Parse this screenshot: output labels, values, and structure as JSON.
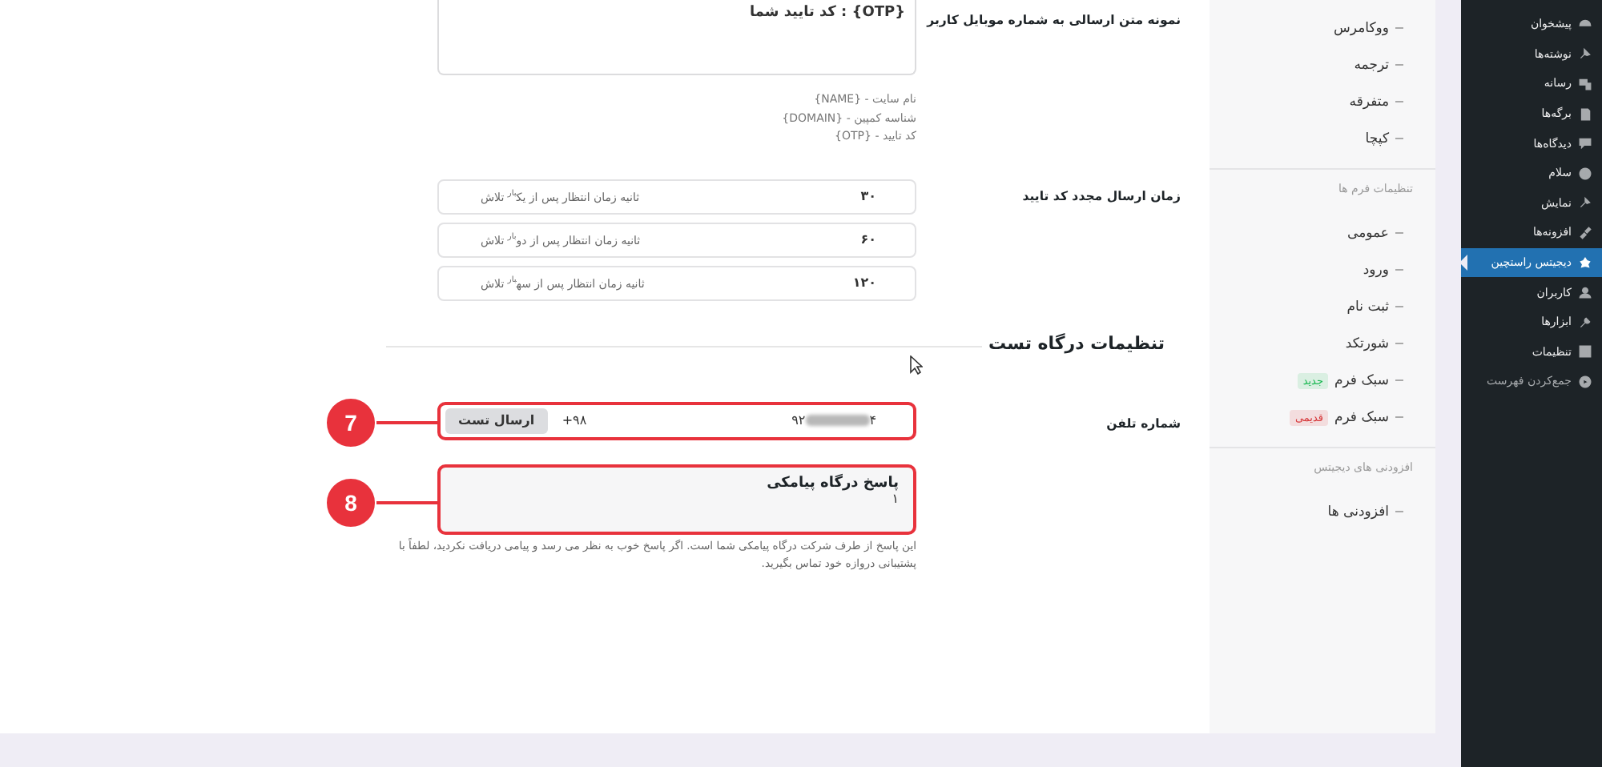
{
  "wp_menu": [
    {
      "label": "پیشخوان",
      "selected": false,
      "dim": false
    },
    {
      "label": "نوشته‌ها",
      "selected": false,
      "dim": false
    },
    {
      "label": "رسانه",
      "selected": false,
      "dim": false
    },
    {
      "label": "برگه‌ها",
      "selected": false,
      "dim": false
    },
    {
      "label": "دیدگاه‌ها",
      "selected": false,
      "dim": false
    },
    {
      "label": "سلام",
      "selected": false,
      "dim": false
    },
    {
      "label": "نمایش",
      "selected": false,
      "dim": false
    },
    {
      "label": "افزونه‌ها",
      "selected": false,
      "dim": false
    },
    {
      "label": "دیجیتس راستچین",
      "selected": true,
      "dim": false
    },
    {
      "label": "کاربران",
      "selected": false,
      "dim": false
    },
    {
      "label": "ابزارها",
      "selected": false,
      "dim": false
    },
    {
      "label": "تنظیمات",
      "selected": false,
      "dim": false
    },
    {
      "label": "جمع‌کردن فهرست",
      "selected": false,
      "dim": true
    }
  ],
  "submenu": [
    {
      "kind": "item",
      "label": "ووکامرس"
    },
    {
      "kind": "item",
      "label": "ترجمه"
    },
    {
      "kind": "item",
      "label": "متفرقه"
    },
    {
      "kind": "item",
      "label": "کپچا"
    },
    {
      "kind": "divider"
    },
    {
      "kind": "header",
      "label": "تنظیمات فرم ها"
    },
    {
      "kind": "item",
      "label": "عمومی"
    },
    {
      "kind": "item",
      "label": "ورود"
    },
    {
      "kind": "item",
      "label": "ثبت نام"
    },
    {
      "kind": "item",
      "label": "شورتکد"
    },
    {
      "kind": "item",
      "label": "سبک فرم",
      "badge": {
        "text": "جدید",
        "color": "#1db954"
      }
    },
    {
      "kind": "item",
      "label": "سبک فرم",
      "badge": {
        "text": "قدیمی",
        "color": "#d63638"
      }
    },
    {
      "kind": "divider"
    },
    {
      "kind": "header",
      "label": "افزودنی های دیجیتس"
    },
    {
      "kind": "item",
      "label": "افزودنی ها"
    }
  ],
  "sms_template": {
    "label": "نمونه متن ارسالی به شماره موبایل کاربر",
    "value": "{OTP} : کد تایید شما",
    "hints": [
      "نام سایت - {NAME}",
      "شناسه کمپین - {DOMAIN}",
      "کد تایید - {OTP}"
    ]
  },
  "resend": {
    "label": "زمان ارسال مجدد کد تایید",
    "rows": [
      {
        "value": "۳۰",
        "text": "ثانیه زمان انتظار پس از یک$^{بار}$ تلاش"
      },
      {
        "value": "۶۰",
        "text": "ثانیه زمان انتظار پس از دو$^{بار}$ تلاش"
      },
      {
        "value": "۱۲۰",
        "text": "ثانیه زمان انتظار پس از سه$^{بار}$ تلاش"
      }
    ]
  },
  "test_section": {
    "title": "تنظیمات درگاه تست",
    "phone": {
      "label": "شماره تلفن",
      "number_start": "۹۲",
      "number_end": "۴",
      "country_code": "+۹۸",
      "button": "ارسال تست",
      "annotation": "7"
    },
    "response": {
      "title": "پاسخ درگاه پیامکی",
      "value": "۱",
      "annotation": "8",
      "help": "این پاسخ از طرف شرکت درگاه پیامکی شما است. اگر پاسخ خوب به نظر می رسد و پیامی دریافت نکردید، لطفاً با پشتیبانی دروازه خود تماس بگیرید."
    }
  }
}
